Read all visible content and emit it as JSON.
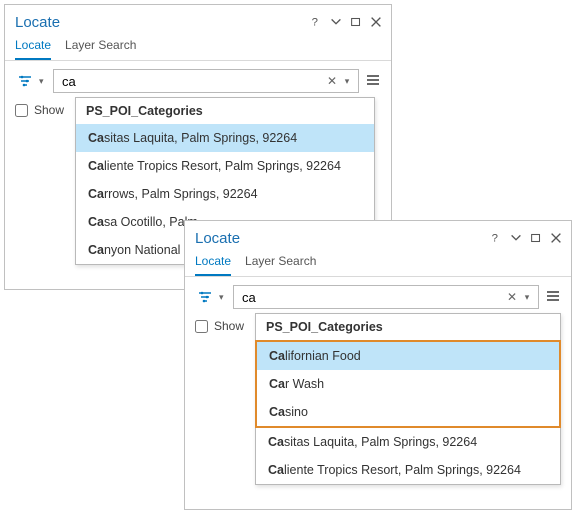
{
  "panel1": {
    "title": "Locate",
    "tabs": {
      "locate": "Locate",
      "layerSearch": "Layer Search"
    },
    "search": {
      "value": "ca",
      "placeholder": ""
    },
    "showLabel": "Show",
    "dropdown": {
      "header": "PS_POI_Categories",
      "items": [
        {
          "match": "Ca",
          "rest": "sitas Laquita, Palm Springs, 92264",
          "selected": true
        },
        {
          "match": "Ca",
          "rest": "liente Tropics Resort, Palm Springs, 92264",
          "selected": false
        },
        {
          "match": "Ca",
          "rest": "rrows, Palm Springs, 92264",
          "selected": false
        },
        {
          "match": "Ca",
          "rest": "sa Ocotillo, Palm",
          "selected": false
        },
        {
          "match": "Ca",
          "rest": "nyon National B",
          "selected": false
        }
      ]
    }
  },
  "panel2": {
    "title": "Locate",
    "tabs": {
      "locate": "Locate",
      "layerSearch": "Layer Search"
    },
    "search": {
      "value": "ca",
      "placeholder": ""
    },
    "showLabel": "Show",
    "dropdown": {
      "header": "PS_POI_Categories",
      "highlighted": [
        {
          "match": "Ca",
          "rest": "lifornian Food",
          "selected": true
        },
        {
          "match": "Ca",
          "rest": "r Wash",
          "selected": false
        },
        {
          "match": "Ca",
          "rest": "sino",
          "selected": false
        }
      ],
      "below": [
        {
          "match": "Ca",
          "rest": "sitas Laquita, Palm Springs, 92264",
          "selected": false
        },
        {
          "match": "Ca",
          "rest": "liente Tropics Resort, Palm Springs, 92264",
          "selected": false
        }
      ]
    }
  }
}
